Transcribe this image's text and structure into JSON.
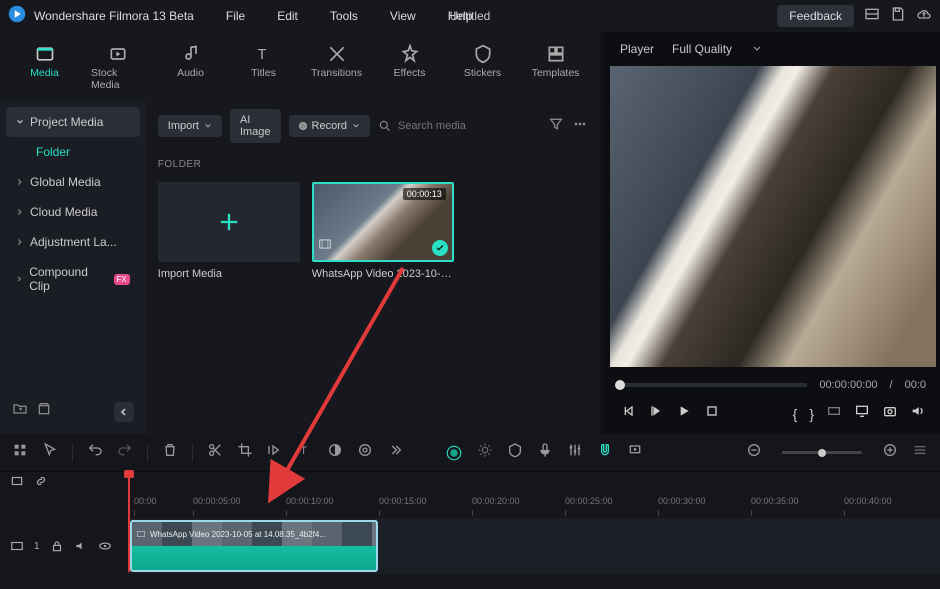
{
  "app": {
    "title": "Wondershare Filmora 13 Beta",
    "doc_title": "Untitled"
  },
  "menu": [
    "File",
    "Edit",
    "Tools",
    "View",
    "Help"
  ],
  "feedback": "Feedback",
  "tabs": [
    {
      "label": "Media",
      "active": true
    },
    {
      "label": "Stock Media"
    },
    {
      "label": "Audio"
    },
    {
      "label": "Titles"
    },
    {
      "label": "Transitions"
    },
    {
      "label": "Effects"
    },
    {
      "label": "Stickers"
    },
    {
      "label": "Templates"
    }
  ],
  "sidebar": {
    "items": [
      {
        "label": "Project Media",
        "active": true
      },
      {
        "label": "Global Media"
      },
      {
        "label": "Cloud Media"
      },
      {
        "label": "Adjustment La..."
      },
      {
        "label": "Compound Clip",
        "badge": "FX"
      }
    ],
    "folder_sub": "Folder"
  },
  "media_toolbar": {
    "import": "Import",
    "ai_image": "AI Image",
    "record": "Record",
    "search_placeholder": "Search media"
  },
  "folder_label": "FOLDER",
  "thumbs": {
    "import_label": "Import Media",
    "clip_label": "WhatsApp Video 2023-10-05...",
    "clip_duration": "00:00:13"
  },
  "player": {
    "tab": "Player",
    "quality": "Full Quality",
    "time_current": "00:00:00:00",
    "time_sep": "/",
    "time_total": "00:0"
  },
  "ruler_ticks": [
    "00:00",
    "00:00:05:00",
    "00:00:10:00",
    "00:00:15:00",
    "00:00:20:00",
    "00:00:25:00",
    "00:00:30:00",
    "00:00:35:00",
    "00:00:40:00"
  ],
  "track": {
    "num": "1"
  },
  "clip_text": "WhatsApp Video 2023-10-05 at 14.08.35_4b2f4..."
}
